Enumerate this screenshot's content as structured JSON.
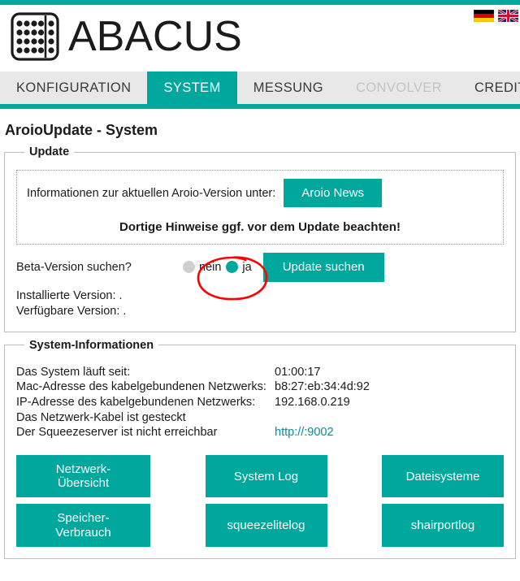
{
  "theme": {
    "accent": "#00a79d",
    "nav_bg": "#e8e8e8",
    "text": "#1b1b1b",
    "disabled_text": "#c4c4c4",
    "link": "#008f9c",
    "radio_off": "#cfcfcf",
    "annotation": "#ff0000"
  },
  "header": {
    "brand": "ABACUS",
    "logo_icon": "abacus-beads-icon",
    "flags": [
      {
        "name": "flag-de-icon",
        "title": "Deutsch"
      },
      {
        "name": "flag-en-icon",
        "title": "English"
      }
    ]
  },
  "nav": {
    "tabs": [
      {
        "label": "KONFIGURATION",
        "state": "normal",
        "key": "konfiguration"
      },
      {
        "label": "SYSTEM",
        "state": "active",
        "key": "system"
      },
      {
        "label": "MESSUNG",
        "state": "normal",
        "key": "messung"
      },
      {
        "label": "CONVOLVER",
        "state": "disabled",
        "key": "convolver"
      },
      {
        "label": "CREDITS",
        "state": "normal",
        "key": "credits"
      }
    ]
  },
  "page": {
    "title": "AroioUpdate - System"
  },
  "update_panel": {
    "legend": "Update",
    "info_text": "Informationen zur aktuellen Aroio-Version unter:",
    "news_button": "Aroio News",
    "notice": "Dortige Hinweise ggf. vor dem Update beachten!",
    "beta_label": "Beta-Version suchen?",
    "radio_no": "nein",
    "radio_yes": "ja",
    "radio_selected": "ja",
    "search_button": "Update suchen",
    "installed_version": "Installierte Version: .",
    "available_version": "Verfügbare Version: ."
  },
  "system_panel": {
    "legend": "System-Informationen",
    "rows": [
      {
        "label": "Das System läuft seit:",
        "value": "01:00:17",
        "is_link": false
      },
      {
        "label": "Mac-Adresse des kabelgebundenen Netzwerks:",
        "value": "b8:27:eb:34:4d:92",
        "is_link": false
      },
      {
        "label": "IP-Adresse des kabelgebundenen Netzwerks:",
        "value": "192.168.0.219",
        "is_link": false
      },
      {
        "label": "Das Netzwerk-Kabel ist gesteckt",
        "value": "",
        "is_link": false
      },
      {
        "label": "Der Squeezeserver ist nicht erreichbar",
        "value": "http://:9002",
        "is_link": true
      }
    ],
    "buttons": [
      {
        "label": "Netzwerk-Übersicht",
        "key": "netzwerk-uebersicht"
      },
      {
        "label": "System Log",
        "key": "system-log"
      },
      {
        "label": "Dateisysteme",
        "key": "dateisysteme"
      },
      {
        "label": "Speicher-Verbrauch",
        "key": "speicher-verbrauch"
      },
      {
        "label": "squeezelitelog",
        "key": "squeezelitelog"
      },
      {
        "label": "shairportlog",
        "key": "shairportlog"
      }
    ]
  }
}
